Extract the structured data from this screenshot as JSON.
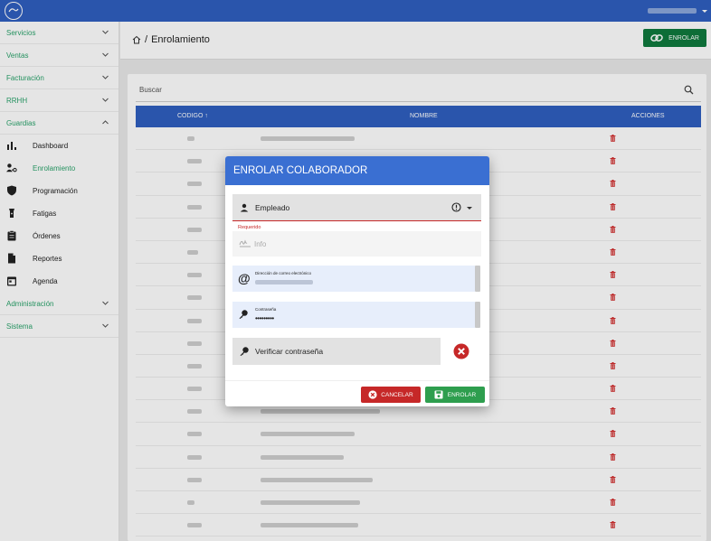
{
  "sidebar": {
    "groups_top": [
      {
        "label": "Servicios"
      },
      {
        "label": "Ventas"
      },
      {
        "label": "Facturación"
      },
      {
        "label": "RRHH"
      }
    ],
    "guardias": {
      "label": "Guardias",
      "items": [
        {
          "label": "Dashboard",
          "icon": "bar-chart-icon"
        },
        {
          "label": "Enrolamiento",
          "icon": "user-key-icon"
        },
        {
          "label": "Programación",
          "icon": "shield-icon"
        },
        {
          "label": "Fatigas",
          "icon": "flashlight-icon"
        },
        {
          "label": "Órdenes",
          "icon": "clipboard-icon"
        },
        {
          "label": "Reportes",
          "icon": "file-icon"
        },
        {
          "label": "Agenda",
          "icon": "calendar-icon"
        }
      ]
    },
    "groups_bottom": [
      {
        "label": "Administración"
      },
      {
        "label": "Sistema"
      }
    ]
  },
  "header": {
    "breadcrumb_sep": "/",
    "page_title": "Enrolamiento",
    "enrolar_button": "ENROLAR"
  },
  "table": {
    "search_placeholder": "Buscar",
    "columns": {
      "codigo": "CODIGO ↑",
      "nombre": "NOMBRE",
      "acciones": "ACCIONES"
    }
  },
  "modal": {
    "title": "ENROLAR COLABORADOR",
    "empleado_label": "Empleado",
    "required_text": "Requerido",
    "info_label": "Info",
    "email_label": "Dirección de correo electrónico",
    "password_label": "Contraseña",
    "password_value": "•••••••••",
    "verify_label": "Verificar contraseña",
    "cancel_button": "CANCELAR",
    "enrolar_button": "ENROLAR"
  },
  "colors": {
    "primary": "#2f5fc0",
    "accent_green": "#2aa36b",
    "danger": "#c62828",
    "success": "#2e9e4e"
  }
}
